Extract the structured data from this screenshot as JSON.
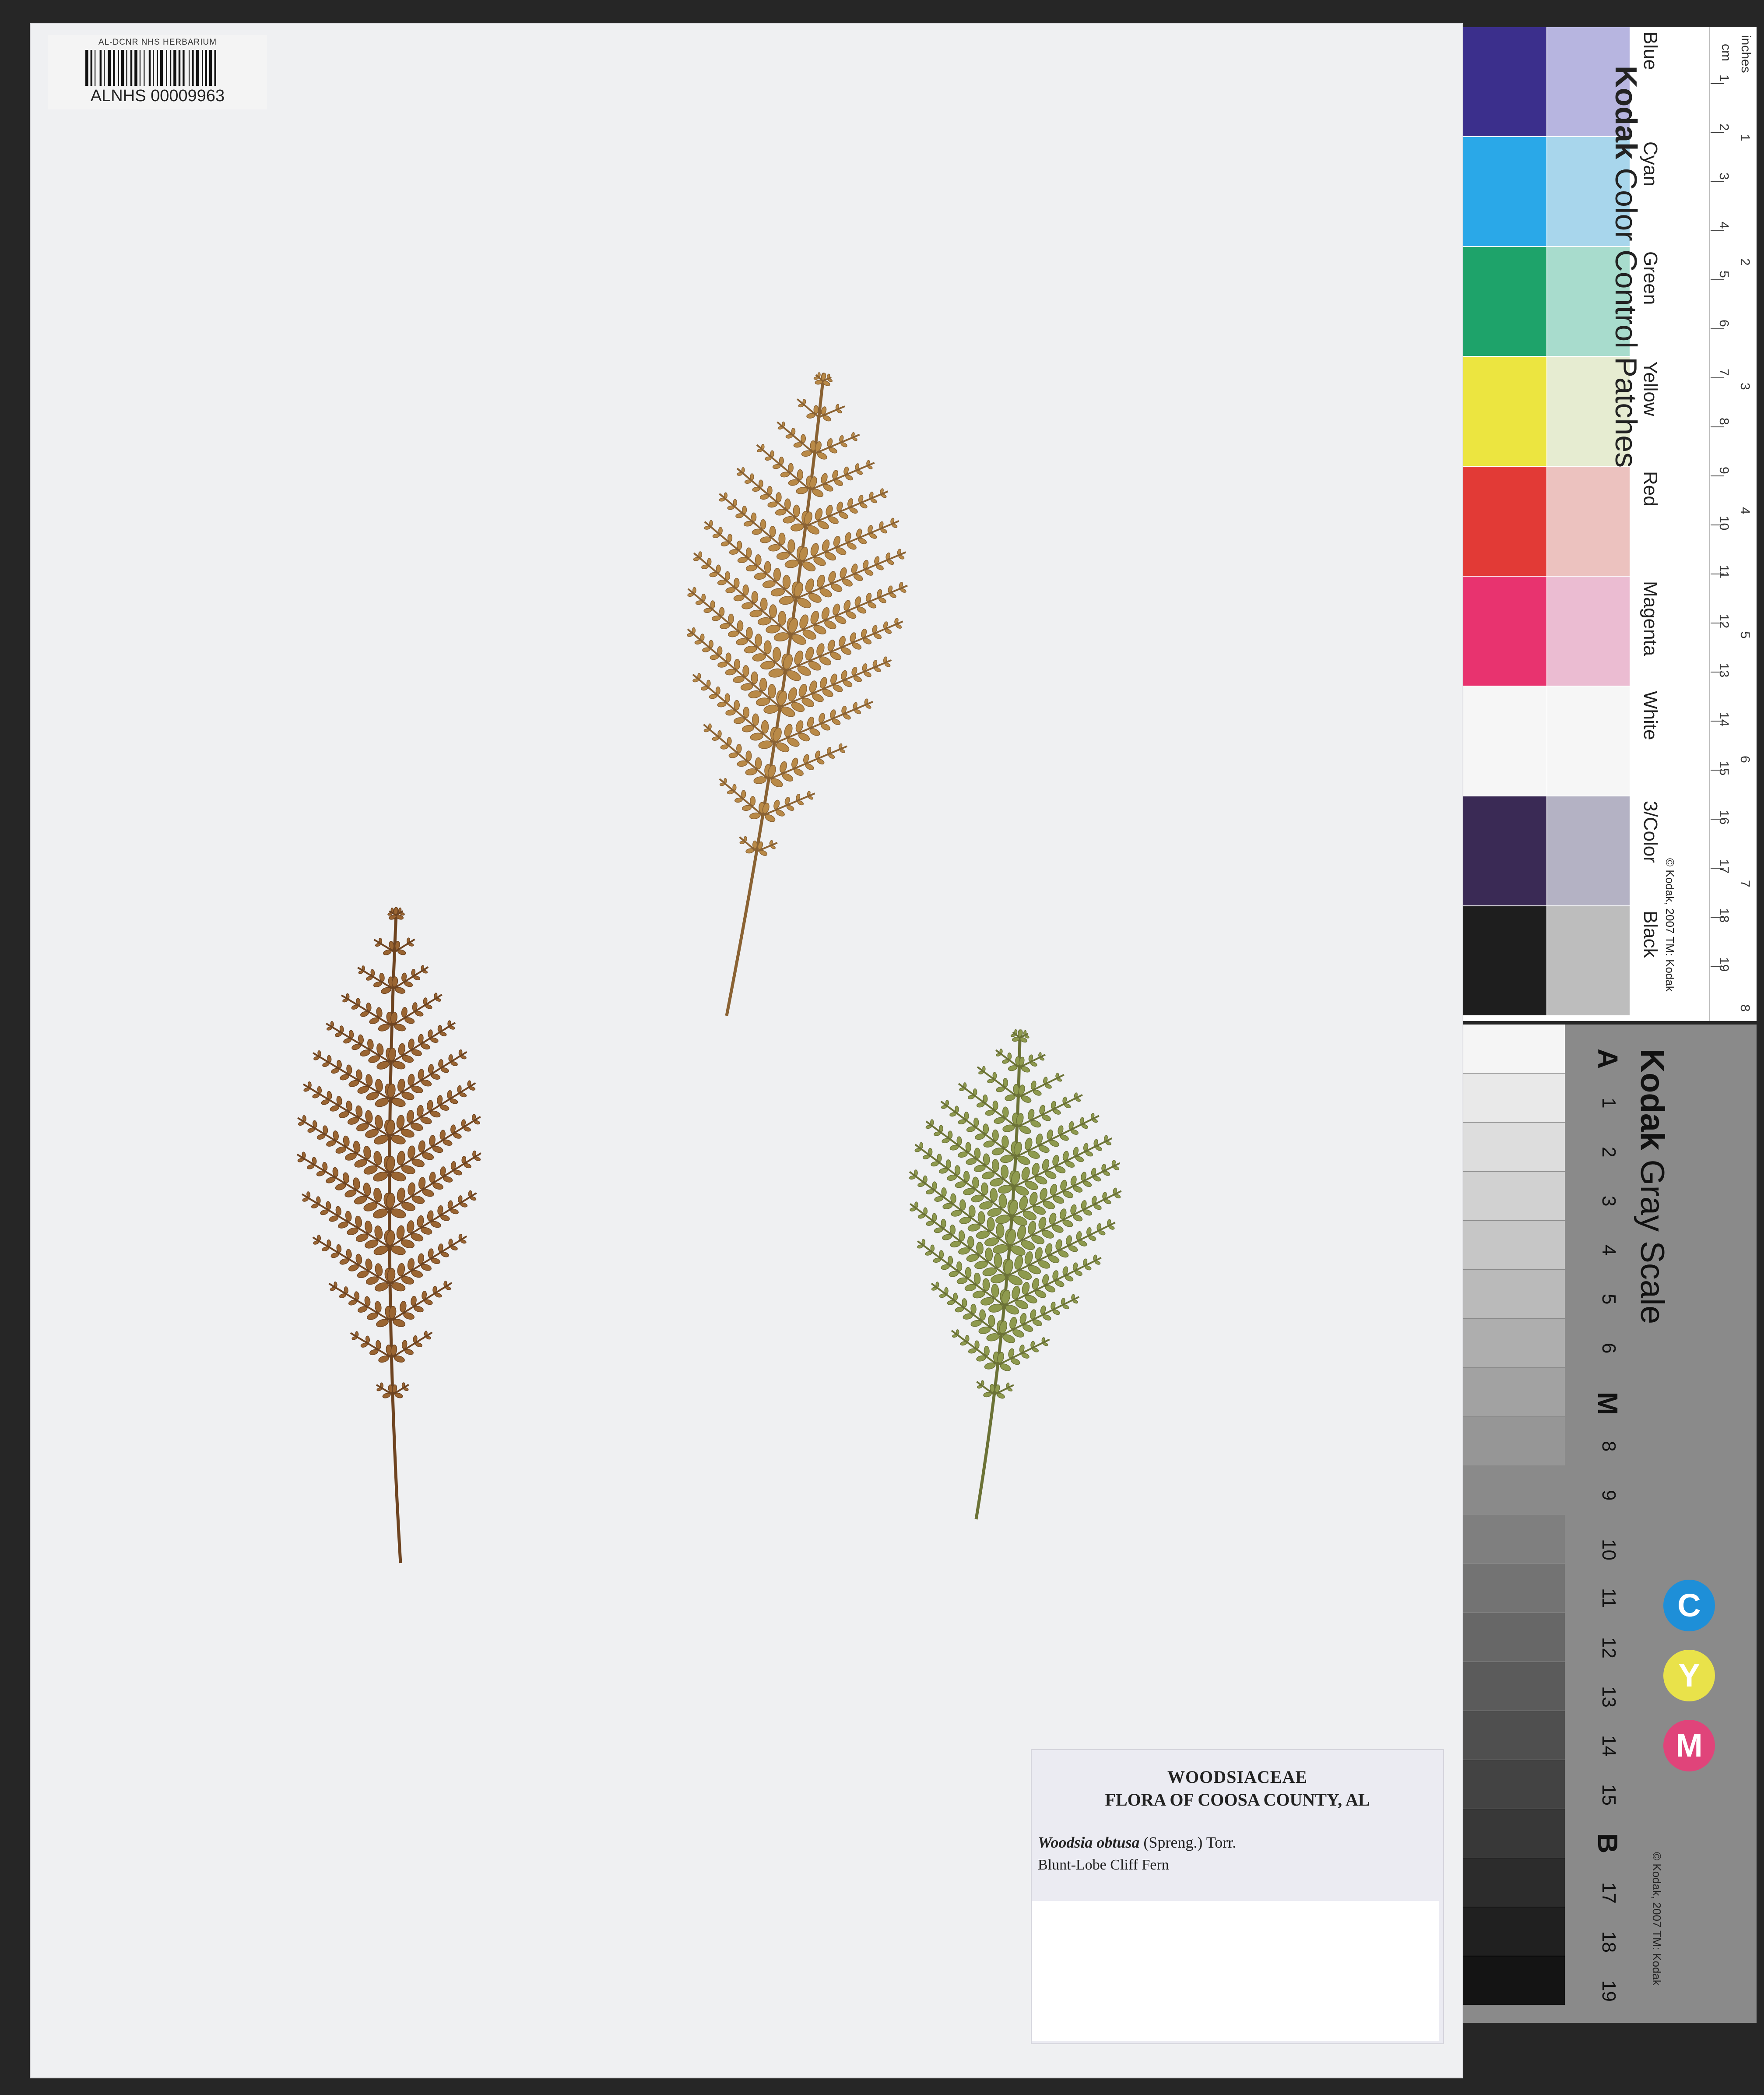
{
  "barcode": {
    "institution": "AL-DCNR NHS HERBARIUM",
    "catalog_number": "ALNHS 00009963"
  },
  "label": {
    "family": "WOODSIACEAE",
    "flora": "FLORA OF COOSA COUNTY, AL",
    "binomial": "Woodsia obtusa",
    "authority": "(Spreng.) Torr.",
    "common_name": "Blunt-Lobe Cliff Fern"
  },
  "color_card": {
    "brand": "Kodak",
    "title": "Color Control Patches",
    "patches": [
      {
        "name": "Blue",
        "dark": "#3b2f8c",
        "light": "#b7b5e0"
      },
      {
        "name": "Cyan",
        "dark": "#2aa8e8",
        "light": "#a8d6ec"
      },
      {
        "name": "Green",
        "dark": "#1ea36a",
        "light": "#a8dccd"
      },
      {
        "name": "Yellow",
        "dark": "#ece540",
        "light": "#e6ecd1"
      },
      {
        "name": "Red",
        "dark": "#e23a36",
        "light": "#ecc2bf"
      },
      {
        "name": "Magenta",
        "dark": "#e8336f",
        "light": "#ebbcd2"
      },
      {
        "name": "White",
        "dark": "#f6f6f6",
        "light": "#f6f6f6"
      },
      {
        "name": "3/Color",
        "dark": "#3a2a55",
        "light": "#b4b2c4"
      },
      {
        "name": "Black",
        "dark": "#1e1e1e",
        "light": "#bdbdbd"
      }
    ],
    "ruler_cm_label": "cm",
    "ruler_inches_label": "inches",
    "copyright": "© Kodak, 2007 TM: Kodak"
  },
  "gray_card": {
    "brand": "Kodak",
    "title": "Gray Scale",
    "labels": [
      "A",
      "1",
      "2",
      "3",
      "4",
      "5",
      "6",
      "M",
      "8",
      "9",
      "10",
      "11",
      "12",
      "13",
      "14",
      "15",
      "B",
      "17",
      "18",
      "19"
    ],
    "cym": [
      {
        "letter": "C",
        "color": "#1e8fd8"
      },
      {
        "letter": "Y",
        "color": "#e9e24a"
      },
      {
        "letter": "M",
        "color": "#e0447a"
      }
    ],
    "copyright": "© Kodak, 2007 TM: Kodak"
  }
}
